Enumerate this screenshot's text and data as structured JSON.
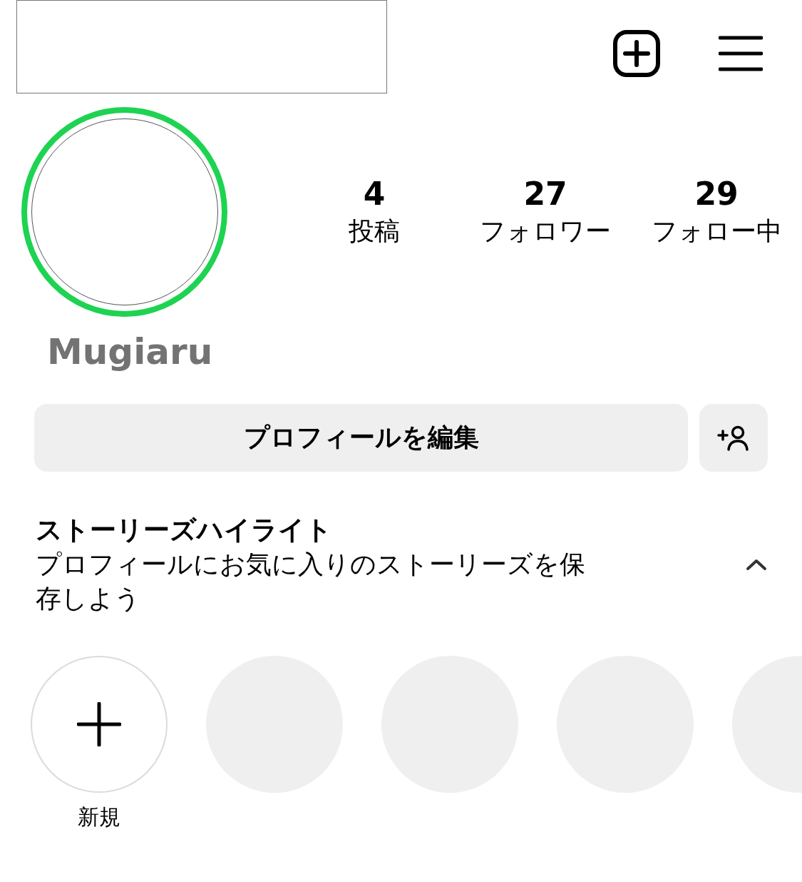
{
  "profile": {
    "story_ring": true,
    "display_name": "Mugiaru"
  },
  "stats": [
    {
      "value": "4",
      "label": "投稿"
    },
    {
      "value": "27",
      "label": "フォロワー"
    },
    {
      "value": "29",
      "label": "フォロー中"
    }
  ],
  "edit_button": "プロフィールを編集",
  "highlights": {
    "title": "ストーリーズハイライト",
    "description": "プロフィールにお気に入りのストーリーズを保存しよう",
    "expanded": true,
    "items": [
      {
        "kind": "new",
        "label": "新規"
      },
      {
        "kind": "empty"
      },
      {
        "kind": "empty"
      },
      {
        "kind": "empty"
      },
      {
        "kind": "empty"
      }
    ]
  }
}
